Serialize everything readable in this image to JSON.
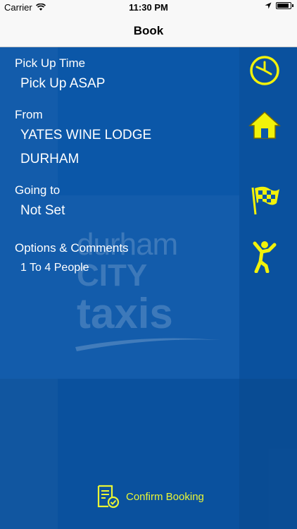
{
  "status_bar": {
    "carrier": "Carrier",
    "time": "11:30 PM"
  },
  "nav": {
    "title": "Book"
  },
  "booking": {
    "pickup_time_label": "Pick Up Time",
    "pickup_time_value": "Pick Up ASAP",
    "from_label": "From",
    "from_line1": "YATES WINE LODGE",
    "from_line2": "DURHAM",
    "going_to_label": "Going to",
    "going_to_value": "Not Set",
    "options_label": "Options & Comments",
    "options_value": "1 To 4 People"
  },
  "icons": {
    "clock": "clock-icon",
    "home": "home-icon",
    "flag": "checkered-flag-icon",
    "person": "person-icon"
  },
  "watermark": {
    "line1": "durham",
    "line2": "CITY",
    "line3": "taxis"
  },
  "footer": {
    "confirm_label": "Confirm Booking"
  },
  "colors": {
    "background": "#0b57a8",
    "icon_yellow": "#f2f20a",
    "confirm_yellow": "#e9f535"
  }
}
